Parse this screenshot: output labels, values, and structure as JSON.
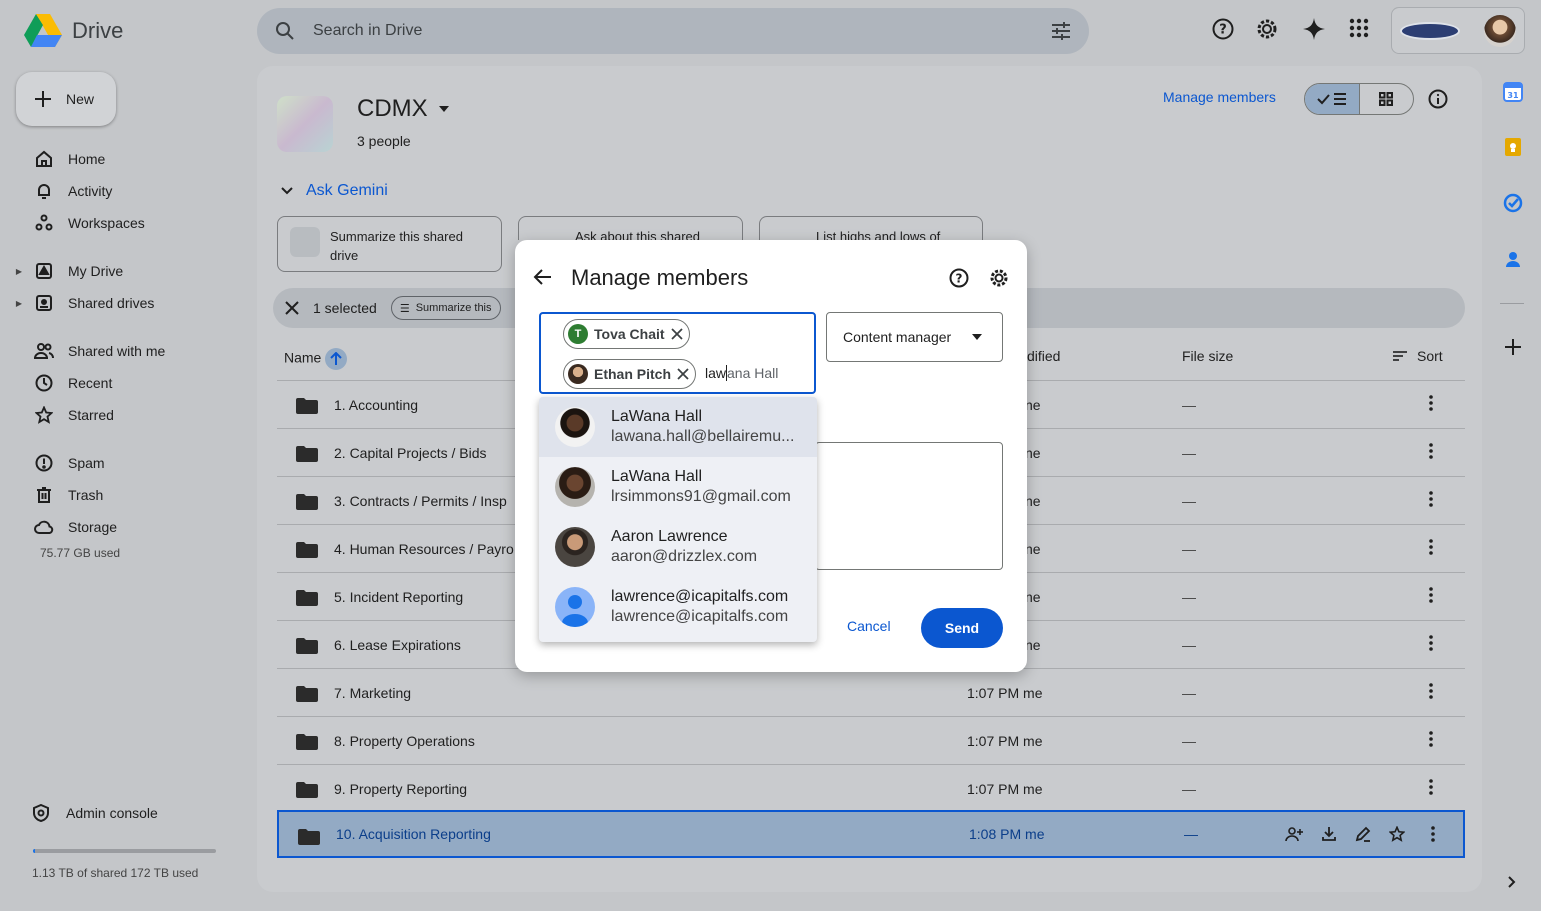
{
  "app": {
    "name": "Drive"
  },
  "search": {
    "placeholder": "Search in Drive"
  },
  "sidebar": {
    "new_label": "New",
    "items": [
      {
        "label": "Home",
        "icon": "home-icon"
      },
      {
        "label": "Activity",
        "icon": "bell-icon"
      },
      {
        "label": "Workspaces",
        "icon": "workspaces-icon"
      },
      {
        "label": "My Drive",
        "icon": "my-drive-icon"
      },
      {
        "label": "Shared drives",
        "icon": "shared-drives-icon"
      },
      {
        "label": "Shared with me",
        "icon": "people-icon"
      },
      {
        "label": "Recent",
        "icon": "clock-icon"
      },
      {
        "label": "Starred",
        "icon": "star-icon"
      },
      {
        "label": "Spam",
        "icon": "spam-icon"
      },
      {
        "label": "Trash",
        "icon": "trash-icon"
      },
      {
        "label": "Storage",
        "icon": "cloud-icon"
      }
    ],
    "storage_used": "75.77 GB used",
    "admin_label": "Admin console",
    "quota_text": "1.13 TB of shared 172 TB used",
    "quota_fraction": 0.0066
  },
  "drive": {
    "title": "CDMX",
    "subtitle": "3 people",
    "manage_label": "Manage members"
  },
  "gemini": {
    "label": "Ask Gemini",
    "chips": [
      "Summarize this shared drive",
      "Ask about this shared",
      "List highs and lows of"
    ]
  },
  "selection": {
    "text": "1 selected",
    "summarize": "Summarize this"
  },
  "table": {
    "col_name": "Name",
    "col_modified": "dified",
    "col_size": "File size",
    "col_sort": "Sort",
    "rows": [
      {
        "name": "1. Accounting",
        "modified": "ne",
        "size": "—"
      },
      {
        "name": "2. Capital Projects / Bids",
        "modified": "ne",
        "size": "—"
      },
      {
        "name": "3. Contracts / Permits / Insp",
        "modified": "ne",
        "size": "—"
      },
      {
        "name": "4. Human Resources / Payro",
        "modified": "ne",
        "size": "—"
      },
      {
        "name": "5. Incident Reporting",
        "modified": "ne",
        "size": "—"
      },
      {
        "name": "6. Lease Expirations",
        "modified": "ne",
        "size": "—"
      },
      {
        "name": "7. Marketing",
        "modified": "1:07 PM me",
        "size": "—"
      },
      {
        "name": "8. Property Operations",
        "modified": "1:07 PM me",
        "size": "—"
      },
      {
        "name": "9. Property Reporting",
        "modified": "1:07 PM me",
        "size": "—"
      },
      {
        "name": "10. Acquisition Reporting",
        "modified": "1:08 PM me",
        "size": "—"
      }
    ]
  },
  "dialog": {
    "title": "Manage members",
    "chips": [
      {
        "name": "Tova Chait",
        "initial": "T"
      },
      {
        "name": "Ethan Pitch"
      }
    ],
    "typed": "law",
    "ghost": "ana Hall",
    "role": "Content manager",
    "cancel": "Cancel",
    "send": "Send"
  },
  "suggestions": [
    {
      "name": "LaWana Hall",
      "email": "lawana.hall@bellairemu..."
    },
    {
      "name": "LaWana Hall",
      "email": "lrsimmons91@gmail.com"
    },
    {
      "name": "Aaron Lawrence",
      "email": "aaron@drizzlex.com"
    },
    {
      "name": "lawrence@icapitalfs.com",
      "email": "lawrence@icapitalfs.com"
    }
  ],
  "colors": {
    "accent": "#0b57d0",
    "selected_row": "#93aac4",
    "tova_avatar": "#2e7d32"
  }
}
